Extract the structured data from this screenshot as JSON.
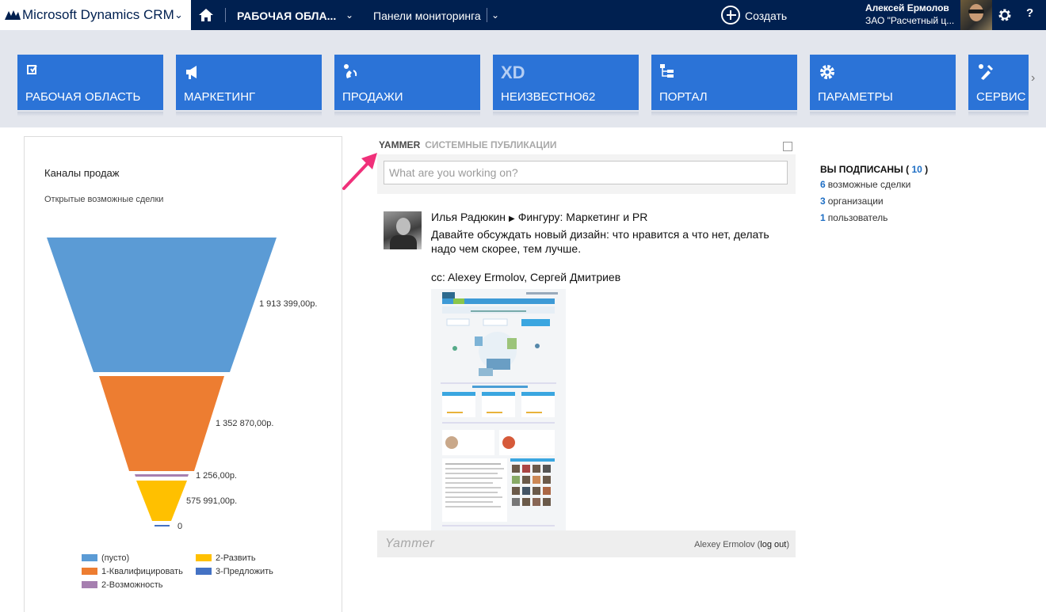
{
  "topbar": {
    "brand": "Microsoft Dynamics CRM",
    "area": "РАБОЧАЯ ОБЛА...",
    "dashboards": "Панели мониторинга",
    "create": "Создать",
    "user_name": "Алексей Ермолов",
    "user_org": "ЗАО \"Расчетный ц...",
    "help": "?"
  },
  "nav": {
    "tiles": [
      {
        "label": "РАБОЧАЯ ОБЛАСТЬ",
        "icon": "workplace-icon"
      },
      {
        "label": "МАРКЕТИНГ",
        "icon": "megaphone-icon"
      },
      {
        "label": "ПРОДАЖИ",
        "icon": "phone-icon"
      },
      {
        "label": "НЕИЗВЕСТНО62",
        "icon": "xd-text-icon",
        "icon_text": "XD"
      },
      {
        "label": "ПОРТАЛ",
        "icon": "sitemap-icon"
      },
      {
        "label": "ПАРАМЕТРЫ",
        "icon": "gear-icon"
      },
      {
        "label": "СЕРВИС",
        "icon": "tools-icon"
      }
    ],
    "next_arrow": "›"
  },
  "chart": {
    "title": "Каналы продаж",
    "subtitle": "Открытые возможные сделки",
    "value_labels": [
      "1 913 399,00р.",
      "1 352 870,00р.",
      "1 256,00р.",
      "575 991,00р.",
      "0"
    ],
    "legend": [
      {
        "label": "(пусто)",
        "color": "#5b9bd5"
      },
      {
        "label": "1-Квалифицировать",
        "color": "#ed7d31"
      },
      {
        "label": "2-Возможность",
        "color": "#a67fb0"
      },
      {
        "label": "2-Развить",
        "color": "#ffc000"
      },
      {
        "label": "3-Предложить",
        "color": "#4472c4"
      }
    ]
  },
  "chart_data": {
    "type": "funnel",
    "title": "Каналы продаж",
    "subtitle": "Открытые возможные сделки",
    "categories": [
      "(пусто)",
      "1-Квалифицировать",
      "2-Возможность",
      "2-Развить",
      "3-Предложить"
    ],
    "values": [
      1913399,
      1352870,
      1256,
      575991,
      0
    ],
    "colors": [
      "#5b9bd5",
      "#ed7d31",
      "#a67fb0",
      "#ffc000",
      "#4472c4"
    ],
    "value_labels": [
      "1 913 399,00р.",
      "1 352 870,00р.",
      "1 256,00р.",
      "575 991,00р.",
      "0"
    ],
    "legend_position": "bottom"
  },
  "yammer": {
    "tab_active": "YAMMER",
    "tab_other": "СИСТЕМНЫЕ ПУБЛИКАЦИИ",
    "composer_placeholder": "What are you working on?",
    "post": {
      "author": "Илья Радюкин",
      "target": "Фингуру: Маркетинг и PR",
      "body": "Давайте обсуждать новый дизайн: что нравится а что нет, делать надо чем скорее, тем лучше.",
      "cc": "cc: Alexey Ermolov, Сергей Дмитриев"
    },
    "footer_logo": "Yammer",
    "footer_user": "Alexey Ermolov",
    "footer_logout": "log out"
  },
  "subscriptions": {
    "title": "ВЫ ПОДПИСАНЫ",
    "count": "10",
    "items": [
      {
        "count": "6",
        "label": "возможные сделки"
      },
      {
        "count": "3",
        "label": "организации"
      },
      {
        "count": "1",
        "label": "пользователь"
      }
    ]
  }
}
